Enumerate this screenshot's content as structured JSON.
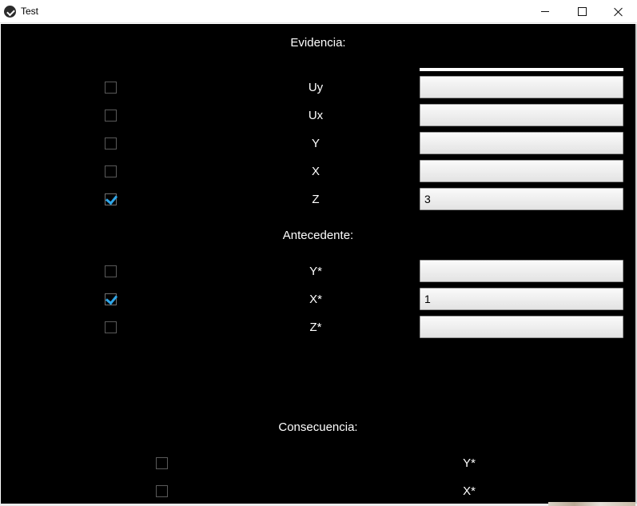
{
  "window": {
    "title": "Test"
  },
  "sections": {
    "evidencia": "Evidencia:",
    "antecedente": "Antecedente:",
    "consecuencia": "Consecuencia:"
  },
  "evidencia_rows": [
    {
      "label": "Uy",
      "checked": false,
      "value": ""
    },
    {
      "label": "Ux",
      "checked": false,
      "value": ""
    },
    {
      "label": "Y",
      "checked": false,
      "value": ""
    },
    {
      "label": "X",
      "checked": false,
      "value": ""
    },
    {
      "label": "Z",
      "checked": true,
      "value": "3"
    }
  ],
  "antecedente_rows": [
    {
      "label": "Y*",
      "checked": false,
      "value": ""
    },
    {
      "label": "X*",
      "checked": true,
      "value": "1"
    },
    {
      "label": "Z*",
      "checked": false,
      "value": ""
    }
  ],
  "consecuencia_rows": [
    {
      "label": "Y*",
      "checked": false
    },
    {
      "label": "X*",
      "checked": false
    }
  ],
  "colors": {
    "background": "#000000",
    "text": "#ffffff",
    "check_accent": "#2fa6e8"
  }
}
